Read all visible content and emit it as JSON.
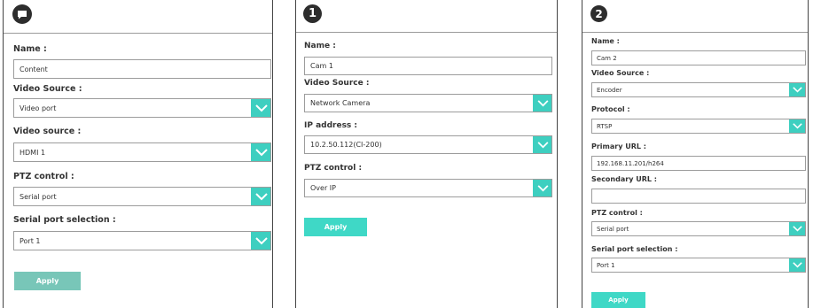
{
  "colors": {
    "accent": "#3ecfc0",
    "button": "#3fd8c6",
    "button_dim": "#78c6b8",
    "border": "#9c9c9c",
    "badge": "#2d2d2d"
  },
  "panel_content": {
    "badge_icon": "chat-bubble-icon",
    "name_label": "Name :",
    "name_value": "Content",
    "video_source_label": "Video Source :",
    "video_source_value": "Video port",
    "video_source2_label": "Video source :",
    "video_source2_value": "HDMI 1",
    "ptz_label": "PTZ control :",
    "ptz_value": "Serial port",
    "serial_label": "Serial port selection :",
    "serial_value": "Port 1",
    "apply_label": "Apply"
  },
  "panel_cam1": {
    "badge": "1",
    "name_label": "Name :",
    "name_value": "Cam 1",
    "video_source_label": "Video Source :",
    "video_source_value": "Network Camera",
    "ip_label": "IP address :",
    "ip_value": "10.2.50.112(CI-200)",
    "ptz_label": "PTZ control :",
    "ptz_value": "Over IP",
    "apply_label": "Apply"
  },
  "panel_cam2": {
    "badge": "2",
    "name_label": "Name :",
    "name_value": "Cam 2",
    "video_source_label": "Video Source :",
    "video_source_value": "Encoder",
    "protocol_label": "Protocol :",
    "protocol_value": "RTSP",
    "primary_url_label": "Primary URL :",
    "primary_url_value": "192.168.11.201/h264",
    "secondary_url_label": "Secondary URL :",
    "secondary_url_value": "",
    "ptz_label": "PTZ control :",
    "ptz_value": "Serial port",
    "serial_label": "Serial port selection :",
    "serial_value": "Port 1",
    "apply_label": "Apply"
  }
}
